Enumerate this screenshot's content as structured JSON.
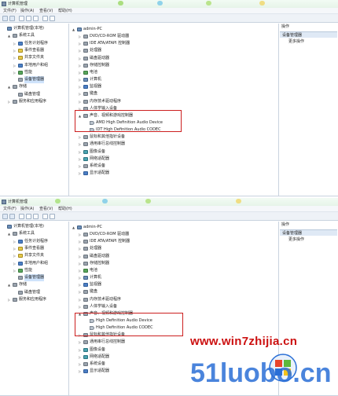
{
  "window": {
    "title": "计算机管理",
    "menu": [
      "文件(F)",
      "操作(A)",
      "查看(V)",
      "帮助(H)"
    ]
  },
  "left_tree": [
    {
      "label": "计算机管理(本地)",
      "icon": "computer-management-icon",
      "expander": "",
      "level": 0,
      "selected": false
    },
    {
      "label": "系统工具",
      "icon": "tools-icon",
      "expander": "▲",
      "level": 1,
      "selected": false
    },
    {
      "label": "任务计划程序",
      "icon": "task-scheduler-icon",
      "expander": "▷",
      "level": 2,
      "selected": false
    },
    {
      "label": "事件查看器",
      "icon": "event-viewer-icon",
      "expander": "▷",
      "level": 2,
      "selected": false
    },
    {
      "label": "共享文件夹",
      "icon": "shared-folder-icon",
      "expander": "▷",
      "level": 2,
      "selected": false
    },
    {
      "label": "本地用户和组",
      "icon": "users-icon",
      "expander": "▷",
      "level": 2,
      "selected": false
    },
    {
      "label": "性能",
      "icon": "performance-icon",
      "expander": "▷",
      "level": 2,
      "selected": false
    },
    {
      "label": "设备管理器",
      "icon": "device-manager-icon",
      "expander": "",
      "level": 2,
      "selected": true
    },
    {
      "label": "存储",
      "icon": "storage-icon",
      "expander": "▲",
      "level": 1,
      "selected": false
    },
    {
      "label": "磁盘管理",
      "icon": "disk-management-icon",
      "expander": "",
      "level": 2,
      "selected": false
    },
    {
      "label": "服务和应用程序",
      "icon": "services-icon",
      "expander": "▷",
      "level": 1,
      "selected": false
    }
  ],
  "device_tree_top": [
    {
      "label": "admin-PC",
      "icon": "computer-icon",
      "expander": "▲",
      "level": 0
    },
    {
      "label": "DVD/CD-ROM 驱动器",
      "icon": "dvd-drive-icon",
      "expander": "▷",
      "level": 1
    },
    {
      "label": "IDE ATA/ATAPI 控制器",
      "icon": "ide-controller-icon",
      "expander": "▷",
      "level": 1
    },
    {
      "label": "处理器",
      "icon": "processor-icon",
      "expander": "▷",
      "level": 1
    },
    {
      "label": "磁盘驱动器",
      "icon": "disk-drive-icon",
      "expander": "▷",
      "level": 1
    },
    {
      "label": "存储控制器",
      "icon": "storage-controller-icon",
      "expander": "▷",
      "level": 1
    },
    {
      "label": "电池",
      "icon": "battery-icon",
      "expander": "▷",
      "level": 1
    },
    {
      "label": "计算机",
      "icon": "computer-icon",
      "expander": "▷",
      "level": 1
    },
    {
      "label": "监视器",
      "icon": "monitor-icon",
      "expander": "▷",
      "level": 1
    },
    {
      "label": "键盘",
      "icon": "keyboard-icon",
      "expander": "▷",
      "level": 1
    },
    {
      "label": "内存技术驱动程序",
      "icon": "memory-icon",
      "expander": "▷",
      "level": 1
    },
    {
      "label": "人体学输入设备",
      "icon": "hid-icon",
      "expander": "▷",
      "level": 1
    },
    {
      "label": "声音、视频和游戏控制器",
      "icon": "sound-controller-icon",
      "expander": "▲",
      "level": 1
    },
    {
      "label": "AMD High Definition Audio Device",
      "icon": "speaker-icon",
      "expander": "",
      "level": 2
    },
    {
      "label": "IDT High Definition Audio CODEC",
      "icon": "speaker-icon",
      "expander": "",
      "level": 2
    },
    {
      "label": "鼠标和其他指针设备",
      "icon": "mouse-icon",
      "expander": "▷",
      "level": 1
    },
    {
      "label": "通用串行总线控制器",
      "icon": "usb-icon",
      "expander": "▷",
      "level": 1
    },
    {
      "label": "图像设备",
      "icon": "imaging-device-icon",
      "expander": "▷",
      "level": 1
    },
    {
      "label": "网络适配器",
      "icon": "network-adapter-icon",
      "expander": "▷",
      "level": 1
    },
    {
      "label": "系统设备",
      "icon": "system-device-icon",
      "expander": "▷",
      "level": 1
    },
    {
      "label": "显示适配器",
      "icon": "display-adapter-icon",
      "expander": "▷",
      "level": 1
    }
  ],
  "device_tree_bottom": [
    {
      "label": "admin-PC",
      "icon": "computer-icon",
      "expander": "▲",
      "level": 0
    },
    {
      "label": "DVD/CD-ROM 驱动器",
      "icon": "dvd-drive-icon",
      "expander": "▷",
      "level": 1
    },
    {
      "label": "IDE ATA/ATAPI 控制器",
      "icon": "ide-controller-icon",
      "expander": "▷",
      "level": 1
    },
    {
      "label": "处理器",
      "icon": "processor-icon",
      "expander": "▷",
      "level": 1
    },
    {
      "label": "磁盘驱动器",
      "icon": "disk-drive-icon",
      "expander": "▷",
      "level": 1
    },
    {
      "label": "存储控制器",
      "icon": "storage-controller-icon",
      "expander": "▷",
      "level": 1
    },
    {
      "label": "电池",
      "icon": "battery-icon",
      "expander": "▷",
      "level": 1
    },
    {
      "label": "计算机",
      "icon": "computer-icon",
      "expander": "▷",
      "level": 1
    },
    {
      "label": "监视器",
      "icon": "monitor-icon",
      "expander": "▷",
      "level": 1
    },
    {
      "label": "键盘",
      "icon": "keyboard-icon",
      "expander": "▷",
      "level": 1
    },
    {
      "label": "内存技术驱动程序",
      "icon": "memory-icon",
      "expander": "▷",
      "level": 1
    },
    {
      "label": "人体学输入设备",
      "icon": "hid-icon",
      "expander": "▷",
      "level": 1
    },
    {
      "label": "声音、视频和游戏控制器",
      "icon": "sound-controller-icon",
      "expander": "▲",
      "level": 1
    },
    {
      "label": "High Definition Audio Device",
      "icon": "speaker-icon",
      "expander": "",
      "level": 2
    },
    {
      "label": "High Definition Audio CODEC",
      "icon": "speaker-icon",
      "expander": "",
      "level": 2
    },
    {
      "label": "鼠标和其他指针设备",
      "icon": "mouse-icon",
      "expander": "▷",
      "level": 1
    },
    {
      "label": "通用串行总线控制器",
      "icon": "usb-icon",
      "expander": "▷",
      "level": 1
    },
    {
      "label": "图像设备",
      "icon": "imaging-device-icon",
      "expander": "▷",
      "level": 1
    },
    {
      "label": "网络适配器",
      "icon": "network-adapter-icon",
      "expander": "▷",
      "level": 1
    },
    {
      "label": "系统设备",
      "icon": "system-device-icon",
      "expander": "▷",
      "level": 1
    },
    {
      "label": "显示适配器",
      "icon": "display-adapter-icon",
      "expander": "▷",
      "level": 1
    }
  ],
  "actions_pane": {
    "header": "操作",
    "section": "设备管理器",
    "more_actions": "更多操作"
  },
  "watermark": {
    "site": "www.win7zhijia.cn",
    "logo_text": "51luobo.cn"
  },
  "colors": {
    "highlight": "#cc1f1f",
    "selection": "#cfe3fb",
    "watermark_red": "#cc1010",
    "watermark_blue": "#2a6fd6"
  }
}
